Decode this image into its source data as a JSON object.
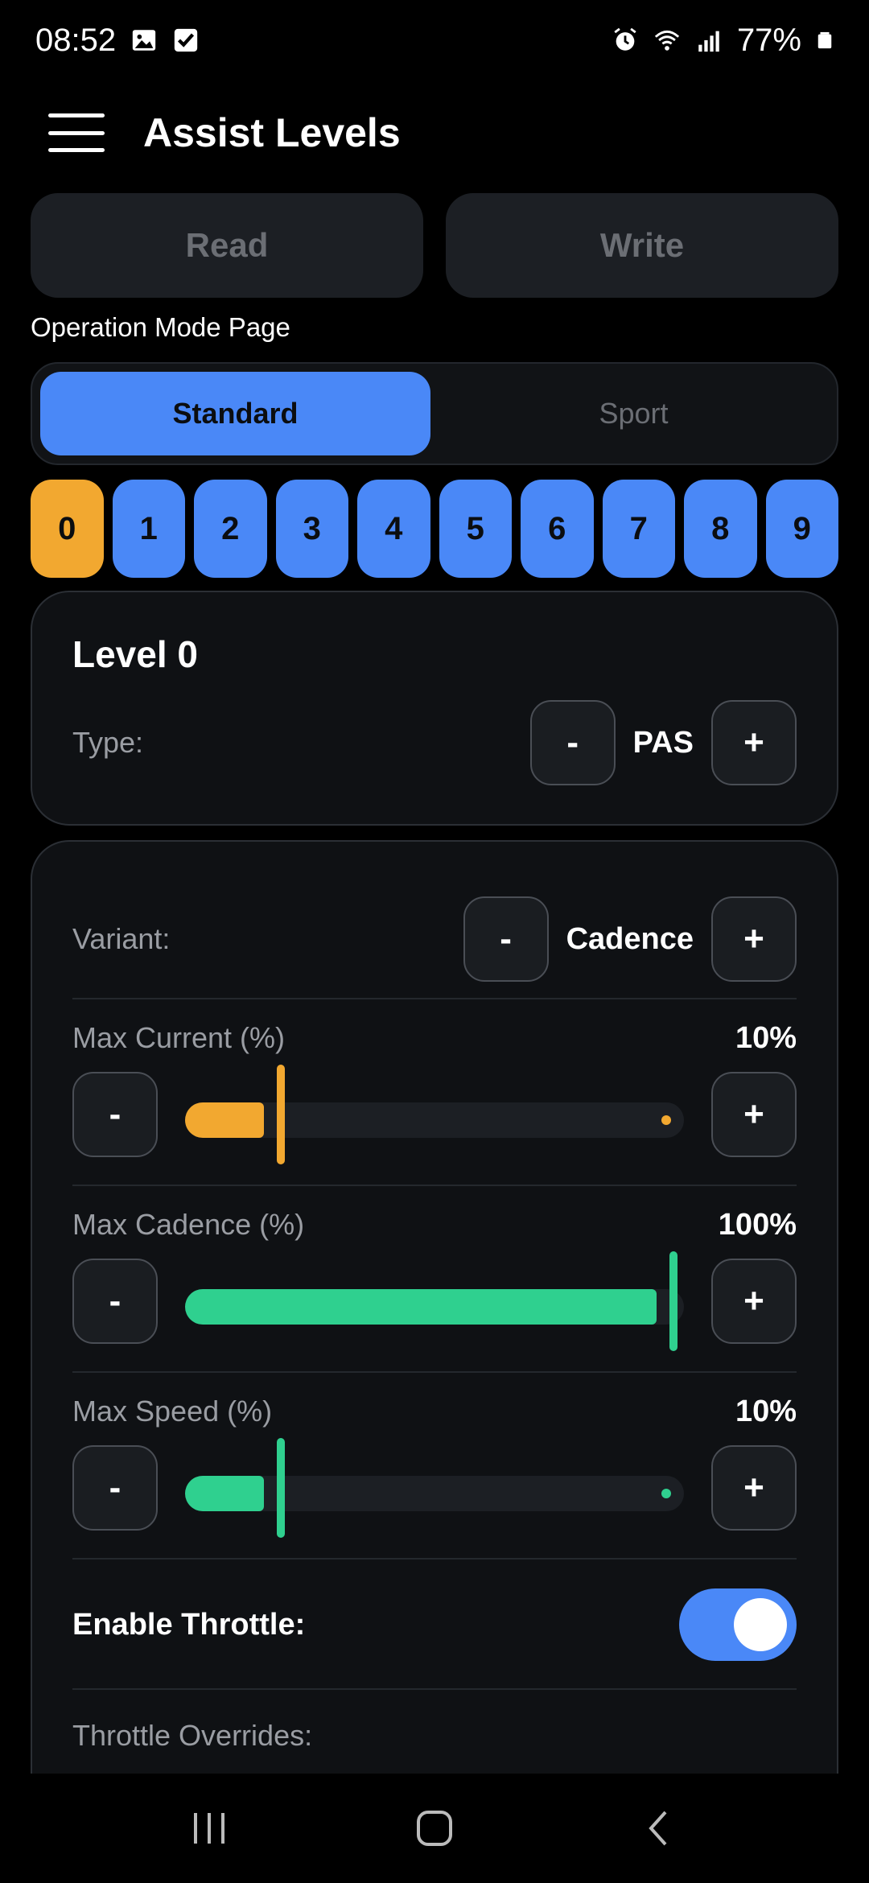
{
  "status": {
    "time": "08:52",
    "battery": "77%",
    "icons_left": [
      "image-icon",
      "checkbox-icon"
    ],
    "icons_right": [
      "alarm-icon",
      "wifi-icon",
      "signal-icon",
      "battery-icon"
    ]
  },
  "header": {
    "title": "Assist Levels"
  },
  "actions": {
    "read": "Read",
    "write": "Write"
  },
  "section_label": "Operation Mode Page",
  "modes": {
    "standard": "Standard",
    "sport": "Sport",
    "selected": "Standard"
  },
  "levels": {
    "items": [
      "0",
      "1",
      "2",
      "3",
      "4",
      "5",
      "6",
      "7",
      "8",
      "9"
    ],
    "selected": "0"
  },
  "level_card": {
    "title": "Level 0",
    "type_label": "Type:",
    "type_value": "PAS",
    "minus": "-",
    "plus": "+"
  },
  "settings": {
    "variant_label": "Variant:",
    "variant_value": "Cadence",
    "minus": "-",
    "plus": "+",
    "sliders": [
      {
        "label": "Max Current (%)",
        "value": "10%",
        "fraction": 0.1,
        "color": "#f2a830"
      },
      {
        "label": "Max Cadence (%)",
        "value": "100%",
        "fraction": 1.0,
        "color": "#2fd08f"
      },
      {
        "label": "Max Speed (%)",
        "value": "10%",
        "fraction": 0.1,
        "color": "#2fd08f"
      }
    ],
    "throttle_label": "Enable Throttle:",
    "throttle_enabled": true,
    "overrides_label": "Throttle Overrides:"
  },
  "colors": {
    "accent": "#4a88f7",
    "selected_level": "#f2a830",
    "current": "#f2a830",
    "cadence": "#2fd08f"
  }
}
